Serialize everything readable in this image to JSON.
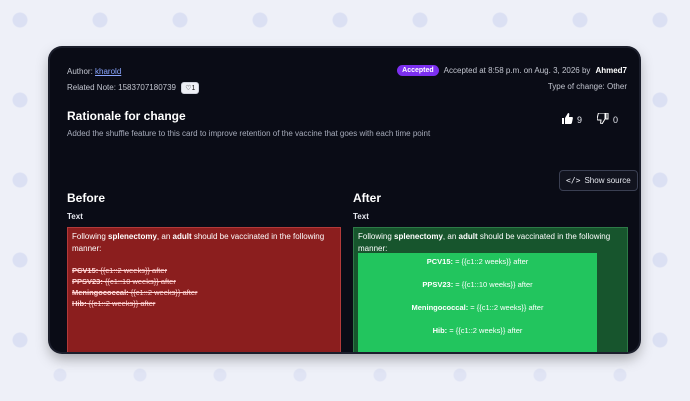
{
  "header": {
    "author_label": "Author:",
    "author_name": "kharold",
    "related_note_label": "Related Note:",
    "related_note_id": "1583707180739",
    "note_badge_count": "1",
    "status_badge": "Accepted",
    "accepted_text": "Accepted at 8:58 p.m. on Aug. 3, 2026 by",
    "accepted_by": "Ahmed7",
    "type_of_change": "Type of change: Other"
  },
  "rationale": {
    "title": "Rationale for change",
    "description": "Added the shuffle feature to this card to improve retention of the vaccine that goes with each time point"
  },
  "votes": {
    "upvotes": "9",
    "downvotes": "0"
  },
  "show_source_label": "Show source",
  "before": {
    "heading": "Before",
    "field_label": "Text",
    "intro_prefix": "Following ",
    "intro_bold1": "splenectomy",
    "intro_mid": ", an ",
    "intro_bold2": "adult",
    "intro_suffix": " should be vaccinated in the following manner:",
    "items": [
      {
        "name": "PCV15:",
        "value": " {{c1::2 weeks}} after"
      },
      {
        "name": "PPSV23:",
        "value": " {{c1::10 weeks}} after"
      },
      {
        "name": "Meningococcal:",
        "value": " {{c1::2 weeks}} after"
      },
      {
        "name": "Hib:",
        "value": " {{c1::2 weeks}} after"
      }
    ]
  },
  "after": {
    "heading": "After",
    "field_label": "Text",
    "intro_prefix": "Following ",
    "intro_bold1": "splenectomy",
    "intro_mid": ", an ",
    "intro_bold2": "adult",
    "intro_suffix": " should be vaccinated in the following manner:",
    "items": [
      {
        "name": "PCV15:",
        "value": " = {{c1::2 weeks}} after"
      },
      {
        "name": "PPSV23:",
        "value": " = {{c1::10 weeks}} after"
      },
      {
        "name": "Meningococcal:",
        "value": " = {{c1::2 weeks}} after"
      },
      {
        "name": "Hib:",
        "value": " = {{c1::2 weeks}} after"
      }
    ]
  },
  "colors": {
    "accepted_badge": "#7c2ff0",
    "before_bg": "#8b1e1e",
    "after_bg": "#17552d",
    "after_inner": "#22c55e"
  }
}
